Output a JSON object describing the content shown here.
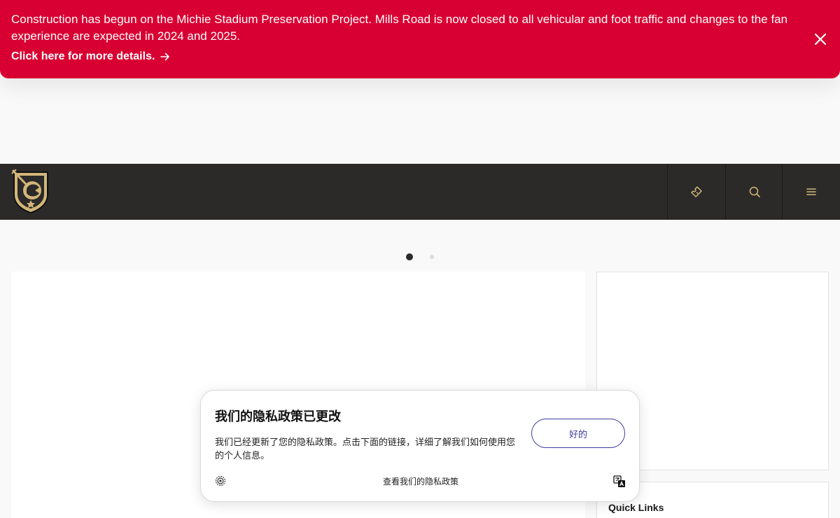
{
  "alert": {
    "message": "Construction has begun on the Michie Stadium Preservation Project. Mills Road is now closed to all vehicular and foot traffic and changes to the fan experience are expected in 2024 and 2025.",
    "link_label": "Click here for more details.",
    "close_icon": "close-icon",
    "color": "#d80032"
  },
  "navbar": {
    "logo_icon": "knight-shield-logo",
    "buttons": [
      "ticket-icon",
      "search-icon",
      "menu-icon"
    ],
    "accent_color": "#d3b67a",
    "background": "#2b2a28"
  },
  "carousel": {
    "active_index": 0,
    "count": 2
  },
  "quick_links": {
    "title": "Quick Links"
  },
  "privacy": {
    "title": "我们的隐私政策已更改",
    "body": "我们已经更新了您的隐私政策。点击下面的链接，详细了解我们如何使用您的个人信息。",
    "ok_label": "好的",
    "link_label": "查看我们的隐私政策",
    "left_icon": "settings-gear-icon",
    "right_icon": "translate-icon"
  }
}
